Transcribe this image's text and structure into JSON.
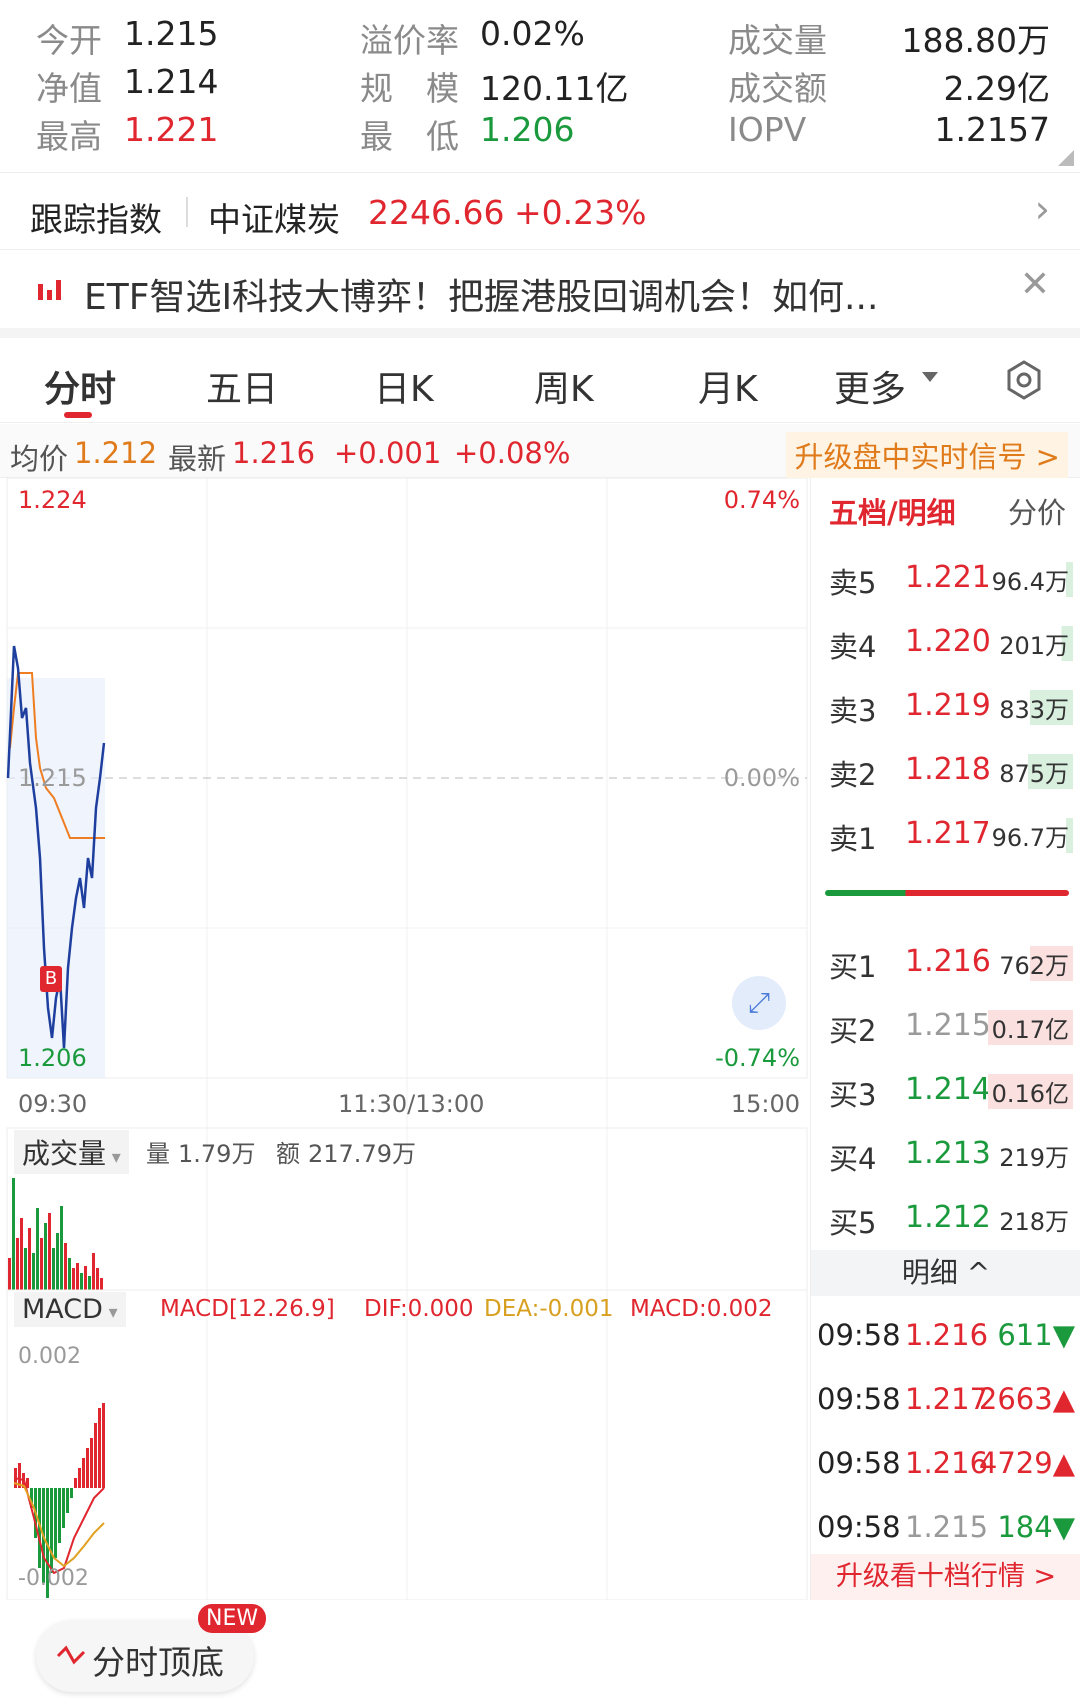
{
  "stats": {
    "open_label": "今开",
    "open": "1.215",
    "nav_label": "净值",
    "nav": "1.214",
    "high_label": "最高",
    "high": "1.221",
    "premium_label": "溢价率",
    "premium": "0.02%",
    "scale_label": "规　模",
    "scale": "120.11亿",
    "low_label": "最　低",
    "low": "1.206",
    "volume_label": "成交量",
    "volume": "188.80万",
    "amount_label": "成交额",
    "amount": "2.29亿",
    "iopv_label": "IOPV",
    "iopv": "1.2157"
  },
  "track": {
    "label": "跟踪指数",
    "index_name": "中证煤炭",
    "index_value": "2246.66",
    "index_change": "+0.23%"
  },
  "news": {
    "text": "ETF智选I科技大博弈！把握港股回调机会！如何..."
  },
  "tabs": [
    "分时",
    "五日",
    "日K",
    "周K",
    "月K",
    "更多"
  ],
  "info": {
    "avg_label": "均价",
    "avg": "1.212",
    "latest_label": "最新",
    "latest": "1.216",
    "change": "+0.001",
    "change_pct": "+0.08%",
    "upgrade": "升级盘中实时信号 >"
  },
  "chart": {
    "max_price": "1.224",
    "max_pct": "0.74%",
    "mid_price": "1.215",
    "mid_pct": "0.00%",
    "min_price": "1.206",
    "min_pct": "-0.74%",
    "time_start": "09:30",
    "time_mid": "11:30/13:00",
    "time_end": "15:00",
    "b_marker": "B",
    "colors": {
      "price": "#1f3f9e",
      "avg": "#ef7d22",
      "up": "#e0262f",
      "down": "#1a9a3c"
    }
  },
  "volume_panel": {
    "selector": "成交量",
    "vol_label": "量",
    "vol": "1.79万",
    "amt_label": "额",
    "amt": "217.79万"
  },
  "macd_panel": {
    "selector": "MACD",
    "params": "MACD[12.26.9]",
    "dif": "DIF:0.000",
    "dea": "DEA:-0.001",
    "macd": "MACD:0.002",
    "top": "0.002",
    "bottom": "-0.002"
  },
  "book": {
    "tab_active": "五档/明细",
    "tab_other": "分价",
    "asks": [
      {
        "label": "卖5",
        "price": "1.221",
        "vol": "96.4万"
      },
      {
        "label": "卖4",
        "price": "1.220",
        "vol": "201万"
      },
      {
        "label": "卖3",
        "price": "1.219",
        "vol": "833万"
      },
      {
        "label": "卖2",
        "price": "1.218",
        "vol": "875万"
      },
      {
        "label": "卖1",
        "price": "1.217",
        "vol": "96.7万"
      }
    ],
    "bids": [
      {
        "label": "买1",
        "price": "1.216",
        "vol": "762万"
      },
      {
        "label": "买2",
        "price": "1.215",
        "vol": "0.17亿"
      },
      {
        "label": "买3",
        "price": "1.214",
        "vol": "0.16亿"
      },
      {
        "label": "买4",
        "price": "1.213",
        "vol": "219万"
      },
      {
        "label": "买5",
        "price": "1.212",
        "vol": "218万"
      }
    ],
    "detail_header": "明细 ^",
    "details": [
      {
        "time": "09:58",
        "price": "1.216",
        "vol": "611▼"
      },
      {
        "time": "09:58",
        "price": "1.217",
        "vol": "2663▲"
      },
      {
        "time": "09:58",
        "price": "1.216",
        "vol": "4729▲"
      },
      {
        "time": "09:58",
        "price": "1.215",
        "vol": "184▼"
      }
    ],
    "upgrade": "升级看十档行情 >"
  },
  "bottom": {
    "button": "分时顶底",
    "badge": "NEW"
  }
}
